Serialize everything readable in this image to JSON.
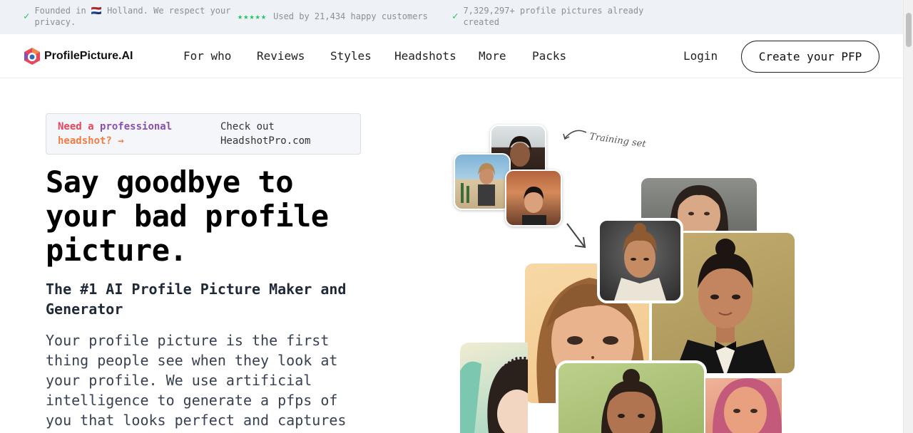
{
  "topbar": {
    "items": [
      {
        "icon": "check-icon",
        "text": "Founded in 🇳🇱 Holland. We respect your privacy."
      },
      {
        "icon": "star-icon",
        "stars": "★★★★★",
        "text": "Used by 21,434 happy customers"
      },
      {
        "icon": "check-icon",
        "text": "7,329,297+ profile pictures already created"
      }
    ]
  },
  "nav": {
    "logo_text": "ProfilePicture.AI",
    "links": [
      "For who",
      "Reviews",
      "Styles",
      "Headshots",
      "More",
      "Packs"
    ],
    "login_label": "Login",
    "cta_label": "Create your PFP"
  },
  "promo": {
    "word1": "Need a",
    "word2": "professional",
    "word3": "headshot?",
    "arrow": "→",
    "right_text": "Check out HeadshotPro.com"
  },
  "hero": {
    "title": "Say goodbye to your bad profile picture.",
    "subtitle": "The #1 AI Profile Picture Maker and Generator",
    "body": "Your profile picture is the first thing people see when they look at your profile. We use artificial intelligence to generate a pfps of you that looks perfect and captures"
  },
  "collage": {
    "training_label": "Training set"
  },
  "colors": {
    "accent_green": "#22c55e",
    "topbar_bg": "#eef1f6",
    "promo_red": "#e8455b",
    "promo_purple": "#8a4fb0",
    "promo_teal": "#2b8aa8",
    "promo_orange": "#ef7d45"
  }
}
